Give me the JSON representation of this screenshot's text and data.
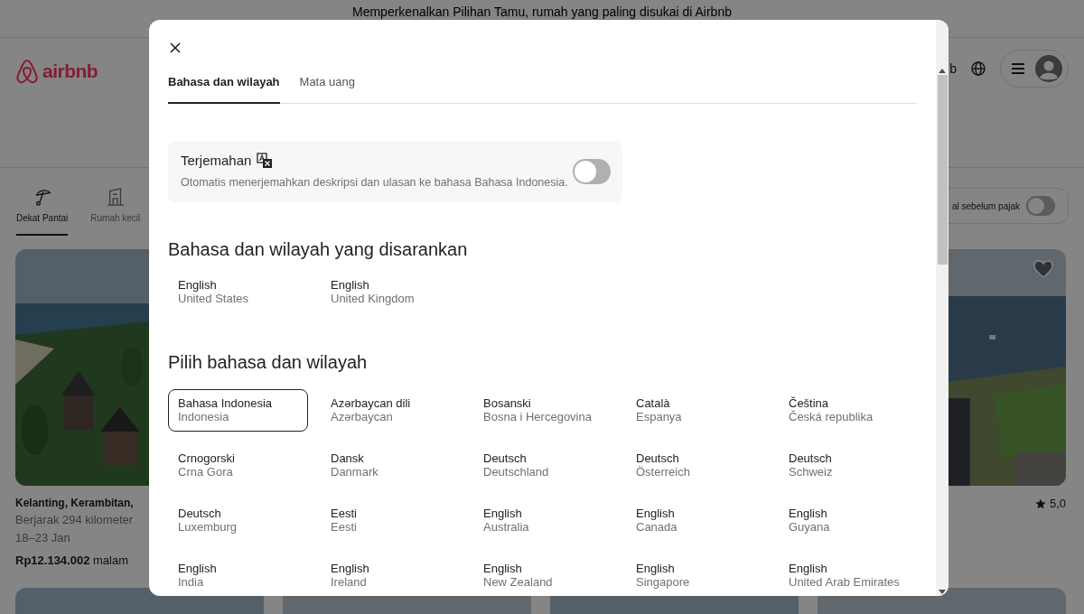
{
  "banner": "Memperkenalkan Pilihan Tamu, rumah yang paling disukai di Airbnb",
  "header": {
    "logo_text": "airbnb",
    "nav_fragment": "b"
  },
  "categories": [
    {
      "label": "Dekat Pantai",
      "selected": true
    },
    {
      "label": "Rumah kecil",
      "selected": false
    }
  ],
  "price_toggle": {
    "label": "al sebelum pajak",
    "on": false
  },
  "listings": [
    {
      "title": "Kelanting, Kerambitan,",
      "distance": "Berjarak 294 kilometer",
      "dates": "18–23 Jan",
      "price": "**Rp12.134.002** malam"
    },
    {
      "rating": "5,0"
    }
  ],
  "modal": {
    "tabs": [
      {
        "label": "Bahasa dan wilayah",
        "selected": true
      },
      {
        "label": "Mata uang",
        "selected": false
      }
    ],
    "translation": {
      "title": "Terjemahan",
      "description": "Otomatis menerjemahkan deskripsi dan ulasan ke bahasa Bahasa Indonesia.",
      "on": false
    },
    "suggested": {
      "title": "Bahasa dan wilayah yang disarankan",
      "items": [
        {
          "language": "English",
          "region": "United States"
        },
        {
          "language": "English",
          "region": "United Kingdom"
        }
      ]
    },
    "all": {
      "title": "Pilih bahasa dan wilayah",
      "items": [
        {
          "language": "Bahasa Indonesia",
          "region": "Indonesia",
          "selected": true
        },
        {
          "language": "Azərbaycan dili",
          "region": "Azərbaycan",
          "selected": false
        },
        {
          "language": "Bosanski",
          "region": "Bosna i Hercegovina",
          "selected": false
        },
        {
          "language": "Català",
          "region": "Espanya",
          "selected": false
        },
        {
          "language": "Čeština",
          "region": "Česká republika",
          "selected": false
        },
        {
          "language": "Crnogorski",
          "region": "Crna Gora",
          "selected": false
        },
        {
          "language": "Dansk",
          "region": "Danmark",
          "selected": false
        },
        {
          "language": "Deutsch",
          "region": "Deutschland",
          "selected": false
        },
        {
          "language": "Deutsch",
          "region": "Österreich",
          "selected": false
        },
        {
          "language": "Deutsch",
          "region": "Schweiz",
          "selected": false
        },
        {
          "language": "Deutsch",
          "region": "Luxemburg",
          "selected": false
        },
        {
          "language": "Eesti",
          "region": "Eesti",
          "selected": false
        },
        {
          "language": "English",
          "region": "Australia",
          "selected": false
        },
        {
          "language": "English",
          "region": "Canada",
          "selected": false
        },
        {
          "language": "English",
          "region": "Guyana",
          "selected": false
        },
        {
          "language": "English",
          "region": "India",
          "selected": false
        },
        {
          "language": "English",
          "region": "Ireland",
          "selected": false
        },
        {
          "language": "English",
          "region": "New Zealand",
          "selected": false
        },
        {
          "language": "English",
          "region": "Singapore",
          "selected": false
        },
        {
          "language": "English",
          "region": "United Arab Emirates",
          "selected": false
        }
      ]
    }
  }
}
